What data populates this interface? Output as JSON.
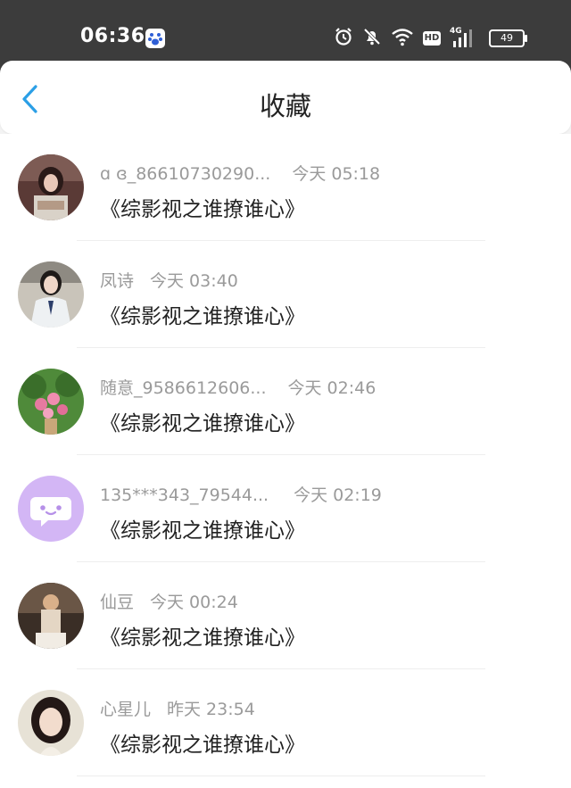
{
  "status_bar": {
    "time": "06:36",
    "network_type": "4G",
    "hd_label": "HD",
    "battery_level": "49",
    "icons": [
      "baidu-app-icon",
      "alarm-icon",
      "mute-bell-icon",
      "wifi-icon",
      "hd-icon",
      "signal-icon",
      "battery-icon"
    ]
  },
  "header": {
    "title": "收藏",
    "back_icon": "chevron-left-icon"
  },
  "colors": {
    "status_bar_bg": "#3c3c3c",
    "accent": "#2b9fe6",
    "text_primary": "#222222",
    "text_secondary": "#9a9a9a"
  },
  "favorites": [
    {
      "user": "ɑ ɞ_86610730290...",
      "time": "今天 05:18",
      "book": "《综影视之谁撩谁心》"
    },
    {
      "user": "凤诗",
      "time": "今天 03:40",
      "book": "《综影视之谁撩谁心》"
    },
    {
      "user": "随意_9586612606...",
      "time": "今天 02:46",
      "book": "《综影视之谁撩谁心》"
    },
    {
      "user": "135***343_79544...",
      "time": "今天 02:19",
      "book": "《综影视之谁撩谁心》"
    },
    {
      "user": "仙豆",
      "time": "今天 00:24",
      "book": "《综影视之谁撩谁心》"
    },
    {
      "user": "心星儿",
      "time": "昨天 23:54",
      "book": "《综影视之谁撩谁心》"
    }
  ]
}
